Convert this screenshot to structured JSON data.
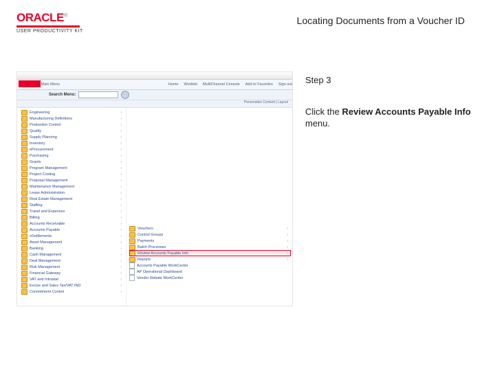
{
  "header": {
    "brand_name": "ORACLE",
    "brand_trademark": "®",
    "brand_subtitle": "USER PRODUCTIVITY KIT",
    "page_title": "Locating Documents from a Voucher ID"
  },
  "instruction": {
    "step_label": "Step 3",
    "text_before": "Click the ",
    "text_bold": "Review Accounts Payable Info",
    "text_after": " menu."
  },
  "screenshot": {
    "topnav": {
      "favorites": "Favorites",
      "main_menu": "Main Menu",
      "home": "Home",
      "worklist": "Worklist",
      "mc": "MultiChannel Console",
      "add_fav": "Add to Favorites",
      "signout": "Sign out"
    },
    "search_label": "Search Menu:",
    "subbar": "Personalize Content | Layout",
    "left_menu": [
      "Engineering",
      "Manufacturing Definitions",
      "Production Control",
      "Quality",
      "Supply Planning",
      "Inventory",
      "eProcurement",
      "Purchasing",
      "Grants",
      "Program Management",
      "Project Costing",
      "Proposal Management",
      "Maintenance Management",
      "Lease Administration",
      "Real Estate Management",
      "Staffing",
      "Travel and Expenses",
      "Billing",
      "Accounts Receivable",
      "Accounts Payable",
      "eSettlements",
      "Asset Management",
      "Banking",
      "Cash Management",
      "Deal Management",
      "Risk Management",
      "Financial Gateway",
      "VAT and Intrastat",
      "Excise and Sales Tax/VAT IND",
      "Commitment Control"
    ],
    "expanded_index": 19,
    "sub_menu": [
      {
        "label": "Vouchers",
        "icon": "folder",
        "highlight": false
      },
      {
        "label": "Control Groups",
        "icon": "folder",
        "highlight": false
      },
      {
        "label": "Payments",
        "icon": "folder",
        "highlight": false
      },
      {
        "label": "Batch Processes",
        "icon": "folder",
        "highlight": false
      },
      {
        "label": "Review Accounts Payable Info",
        "icon": "folder",
        "highlight": true
      },
      {
        "label": "Reports",
        "icon": "folder",
        "highlight": false
      },
      {
        "label": "Accounts Payable WorkCenter",
        "icon": "doc",
        "highlight": false
      },
      {
        "label": "AP Operational Dashboard",
        "icon": "doc",
        "highlight": false
      },
      {
        "label": "Vendor Rebate WorkCenter",
        "icon": "doc",
        "highlight": false
      }
    ]
  }
}
